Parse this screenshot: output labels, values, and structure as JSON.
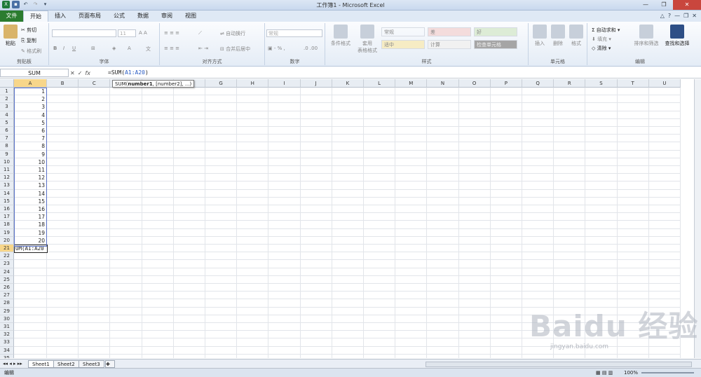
{
  "app": {
    "title": "工作簿1 - Microsoft Excel"
  },
  "tabs": {
    "file": "文件",
    "items": [
      "开始",
      "插入",
      "页面布局",
      "公式",
      "数据",
      "审阅",
      "视图"
    ]
  },
  "ribbon": {
    "clipboard": {
      "label": "剪贴板",
      "paste": "粘贴",
      "cut": "剪切",
      "copy": "复制",
      "format_painter": "格式刷"
    },
    "font": {
      "label": "字体",
      "size": "11"
    },
    "alignment": {
      "label": "对齐方式",
      "wrap": "自动换行",
      "merge": "合并后居中"
    },
    "number": {
      "label": "数字",
      "format": "常规"
    },
    "styles": {
      "label": "样式",
      "cond_format": "条件格式",
      "table_format": "套用\n表格格式",
      "items": [
        "常规",
        "差",
        "好",
        "适中",
        "计算",
        "检查单元格"
      ]
    },
    "cells": {
      "label": "单元格",
      "insert": "插入",
      "delete": "删除",
      "format": "格式"
    },
    "editing": {
      "label": "编辑",
      "autosum": "自动求和",
      "fill": "填充",
      "clear": "清除",
      "sort": "排序和筛选",
      "find": "查找和选择"
    }
  },
  "formula_bar": {
    "name_box": "SUM",
    "prefix": "=SUM(",
    "arg": "A1:A20",
    "suffix": ")",
    "fx": "fx"
  },
  "tooltip": {
    "fn": "SUM(",
    "bold": "number1",
    "rest": ", [number2], ...)"
  },
  "grid": {
    "columns": [
      "A",
      "B",
      "C",
      "D",
      "E",
      "F",
      "G",
      "H",
      "I",
      "J",
      "K",
      "L",
      "M",
      "N",
      "O",
      "P",
      "Q",
      "R",
      "S",
      "T",
      "U"
    ],
    "rows": [
      "1",
      "2",
      "3",
      "4",
      "5",
      "6",
      "7",
      "8",
      "9",
      "10",
      "11",
      "12",
      "13",
      "14",
      "15",
      "16",
      "17",
      "18",
      "19",
      "20",
      "21",
      "22",
      "23",
      "24",
      "25",
      "26",
      "27",
      "28",
      "29",
      "30",
      "31",
      "32",
      "33",
      "34",
      "35"
    ],
    "a_values": [
      "1",
      "2",
      "3",
      "4",
      "5",
      "6",
      "7",
      "8",
      "9",
      "10",
      "11",
      "12",
      "13",
      "14",
      "15",
      "16",
      "17",
      "18",
      "19",
      "20"
    ],
    "editing_cell": "UM(A1:A20"
  },
  "sheets": [
    "Sheet1",
    "Sheet2",
    "Sheet3"
  ],
  "status": {
    "mode": "编辑",
    "zoom": "100%"
  },
  "watermark": {
    "text": "Baidu 经验",
    "sub": "jingyan.baidu.com"
  }
}
